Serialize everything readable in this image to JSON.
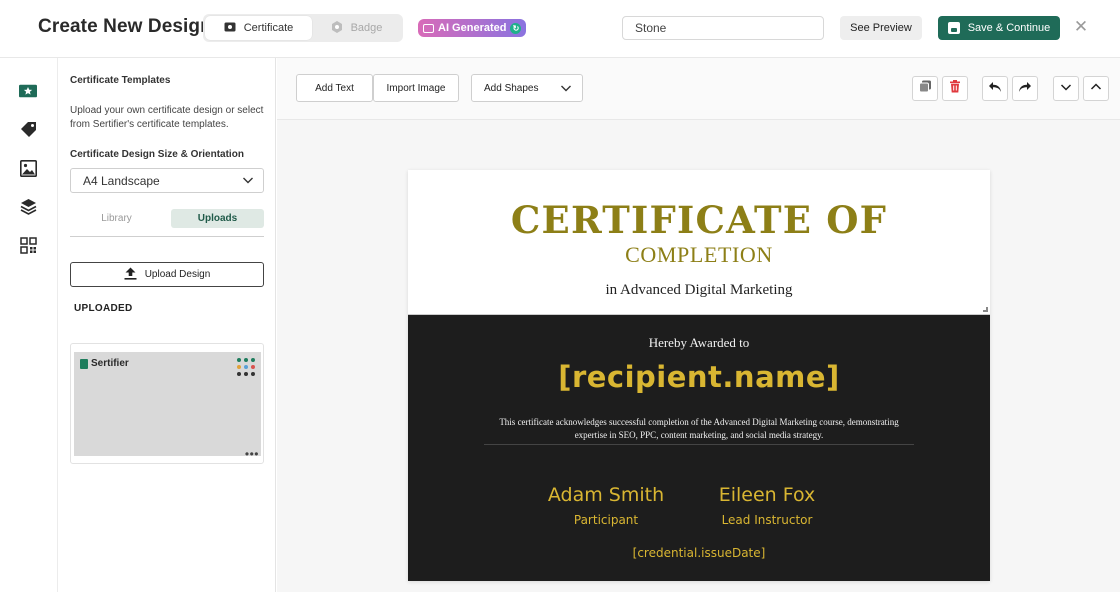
{
  "header": {
    "title": "Create New Design",
    "type_toggle": [
      {
        "label": "Certificate",
        "icon": "certificate-icon",
        "active": true
      },
      {
        "label": "Badge",
        "icon": "badge-icon",
        "active": false
      }
    ],
    "ai_badge": "AI Generated",
    "design_name_value": "Stone",
    "preview_label": "See Preview",
    "save_label": "Save & Continue",
    "close_icon": "close-icon"
  },
  "rail": {
    "items": [
      "certificate-icon",
      "tag-icon",
      "image-icon",
      "layers-icon",
      "qr-code-icon"
    ]
  },
  "panel": {
    "heading": "Certificate Templates",
    "description": "Upload your own certificate design or select from Sertifier's certificate templates.",
    "size_label": "Certificate Design Size & Orientation",
    "size_value": "A4 Landscape",
    "tabs": [
      "Library",
      "Uploads"
    ],
    "active_tab": "Uploads",
    "upload_label": "Upload Design",
    "uploaded_heading": "UPLOADED",
    "thumbnail_logo_text": "Sertifier"
  },
  "toolbar": {
    "add_text": "Add Text",
    "import_image": "Import Image",
    "add_shapes": "Add Shapes"
  },
  "certificate": {
    "title": "CERTIFICATE OF",
    "subtitle": "COMPLETION",
    "course": "in Advanced Digital Marketing",
    "awarded": "Hereby Awarded to",
    "recipient": "[recipient.name]",
    "statement_line1": "This certificate acknowledges successful completion of the Advanced Digital Marketing course, demonstrating",
    "statement_line2": "expertise in SEO, PPC, content marketing, and social media strategy.",
    "signatures": [
      {
        "name": "Adam Smith",
        "role": "Participant"
      },
      {
        "name": "Eileen Fox",
        "role": "Lead Instructor"
      }
    ],
    "issue_date": "[credential.issueDate]"
  },
  "colors": {
    "brand": "#1f6b58",
    "gold": "#d9b632",
    "title_gold": "#8d7f17",
    "dark_panel": "#1d1d1d"
  }
}
